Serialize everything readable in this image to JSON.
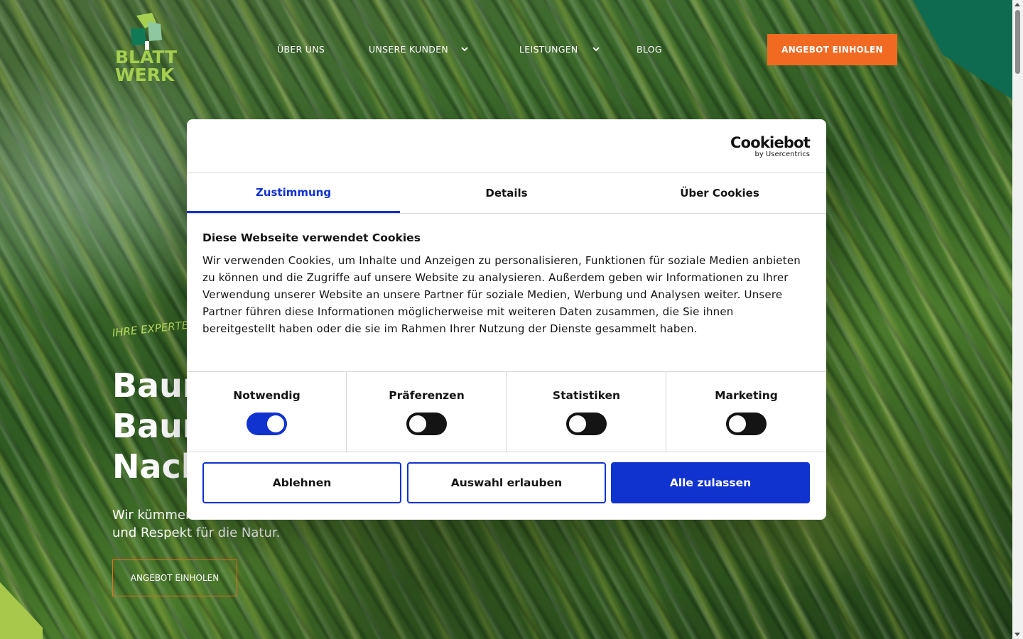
{
  "header": {
    "logo_text_line1": "BLATT",
    "logo_text_line2": "WERK",
    "nav": [
      {
        "label": "ÜBER UNS"
      },
      {
        "label": "UNSERE KUNDEN"
      },
      {
        "label": "LEISTUNGEN"
      },
      {
        "label": "BLOG"
      }
    ],
    "cta_label": "ANGEBOT EINHOLEN"
  },
  "hero": {
    "eyebrow": "IHRE EXPERTE",
    "headline_lines": [
      "Baum",
      "Baum",
      "Nach"
    ],
    "subline_line1": "Wir kümmer",
    "subline_line2": "und Respekt für die Natur.",
    "cta_label": "ANGEBOT EINHOLEN"
  },
  "cookie_dialog": {
    "brand": "Cookiebot",
    "brand_sub": "by Usercentrics",
    "tabs": [
      {
        "label": "Zustimmung",
        "active": true
      },
      {
        "label": "Details",
        "active": false
      },
      {
        "label": "Über Cookies",
        "active": false
      }
    ],
    "title": "Diese Webseite verwendet Cookies",
    "text": "Wir verwenden Cookies, um Inhalte und Anzeigen zu personalisieren, Funktionen für soziale Medien anbieten zu können und die Zugriffe auf unsere Website zu analysieren. Außerdem geben wir Informationen zu Ihrer Verwendung unserer Website an unsere Partner für soziale Medien, Werbung und Analysen weiter. Unsere Partner führen diese Informationen möglicherweise mit weiteren Daten zusammen, die Sie ihnen bereitgestellt haben oder die sie im Rahmen Ihrer Nutzung der Dienste gesammelt haben.",
    "categories": [
      {
        "label": "Notwendig",
        "enabled": true
      },
      {
        "label": "Präferenzen",
        "enabled": false
      },
      {
        "label": "Statistiken",
        "enabled": false
      },
      {
        "label": "Marketing",
        "enabled": false
      }
    ],
    "buttons": {
      "decline": "Ablehnen",
      "allow_selection": "Auswahl erlauben",
      "allow_all": "Alle zulassen"
    }
  },
  "colors": {
    "accent_orange": "#f26a22",
    "cookiebot_blue": "#1032cf",
    "logo_green": "#a5cf4f"
  }
}
